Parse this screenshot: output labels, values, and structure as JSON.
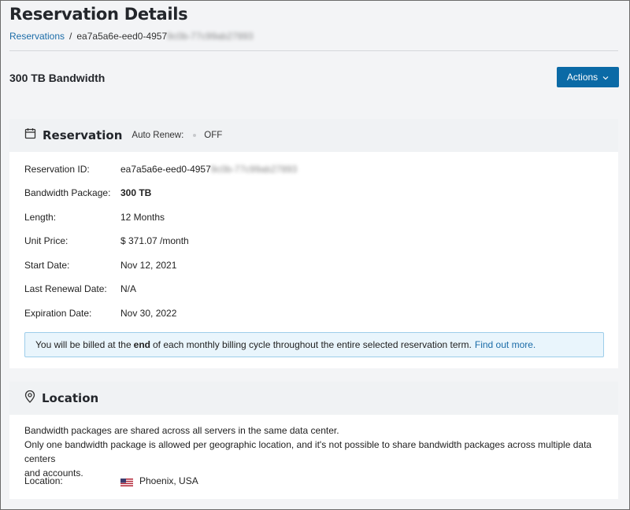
{
  "header": {
    "title": "Reservation Details",
    "breadcrumb_link": "Reservations",
    "breadcrumb_sep": "/",
    "breadcrumb_current": "ea7a5a6e-eed0-4957",
    "breadcrumb_blurred": "9c0b-77c99ab27893"
  },
  "toolbar": {
    "subtitle": "300 TB Bandwidth",
    "actions_label": "Actions"
  },
  "reservation": {
    "title": "Reservation",
    "auto_renew_label": "Auto Renew:",
    "auto_renew_value": "OFF",
    "fields": [
      {
        "label": "Reservation ID:",
        "value": "ea7a5a6e-eed0-4957",
        "blurred": "9c0b-77c99ab27893"
      },
      {
        "label": "Bandwidth Package:",
        "value": "300 TB"
      },
      {
        "label": "Length:",
        "value": "12 Months"
      },
      {
        "label": "Unit Price:",
        "value": "$ 371.07 /month"
      },
      {
        "label": "Start Date:",
        "value": "Nov 12, 2021"
      },
      {
        "label": "Last Renewal Date:",
        "value": "N/A"
      },
      {
        "label": "Expiration Date:",
        "value": "Nov 30, 2022"
      }
    ],
    "notice": {
      "before": "You will be billed at the",
      "bold": "end",
      "after": "of each monthly billing cycle throughout the entire selected reservation term.",
      "link": "Find out more."
    }
  },
  "location": {
    "title": "Location",
    "line1": "Bandwidth packages are shared across all servers in the same data center.",
    "line2": "Only one bandwidth package is allowed per geographic location, and it's not possible to share bandwidth packages across multiple data centers",
    "line3": "and accounts.",
    "label": "Location:",
    "value": "Phoenix, USA"
  },
  "colors": {
    "accent": "#0b6aa6",
    "link": "#1b6ca8",
    "notice_bg": "#e9f5fc"
  }
}
